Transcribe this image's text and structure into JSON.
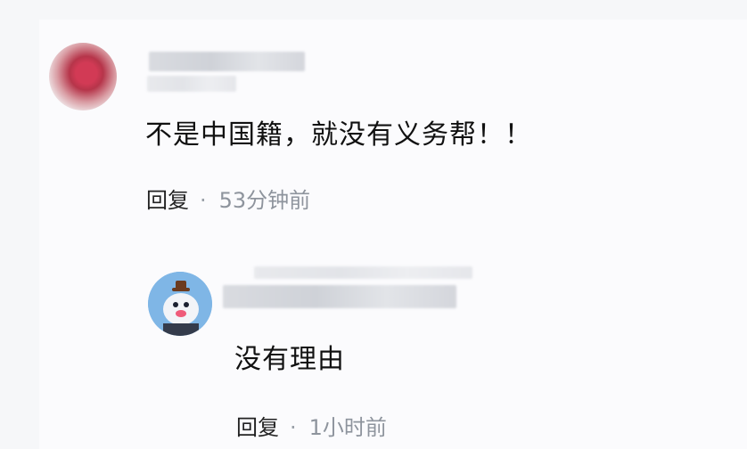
{
  "comments": [
    {
      "text": "不是中国籍，就没有义务帮！！",
      "reply_label": "回复",
      "separator": "·",
      "time": "53分钟前"
    },
    {
      "text": "没有理由",
      "reply_label": "回复",
      "separator": "·",
      "time": "1小时前"
    }
  ],
  "colors": {
    "background": "#fbfbfd",
    "text": "#111111",
    "meta_text": "#8e949d"
  }
}
